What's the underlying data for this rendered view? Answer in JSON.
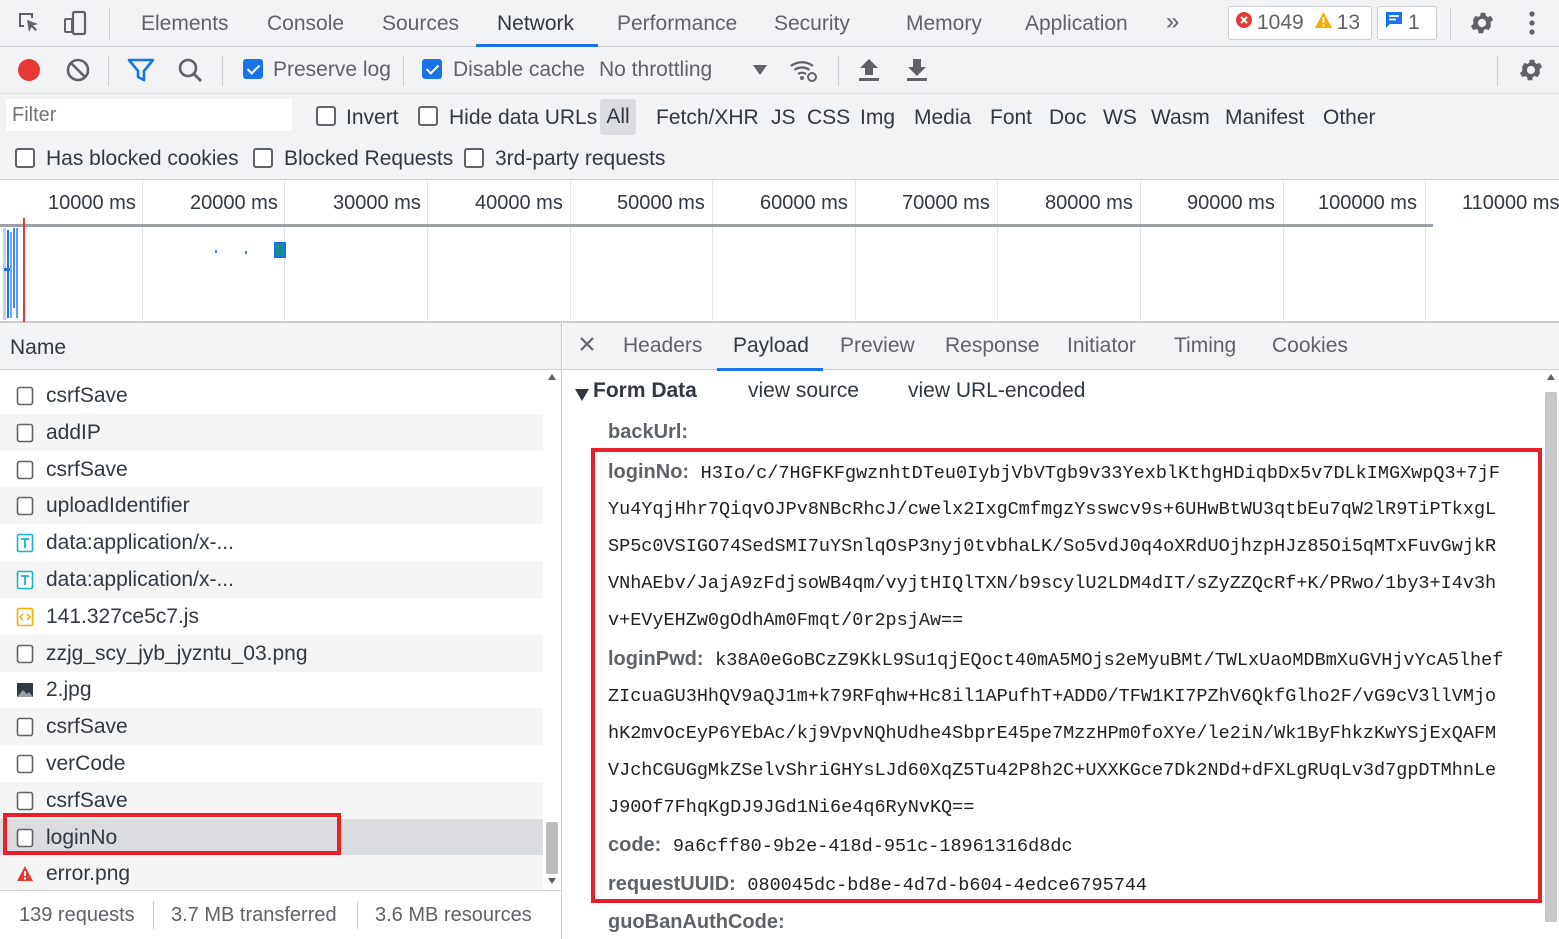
{
  "main_tabs": [
    "Elements",
    "Console",
    "Sources",
    "Network",
    "Performance",
    "Security",
    "Memory",
    "Application"
  ],
  "more_tabs_glyph": "»",
  "counters": {
    "errors": "1049",
    "warnings": "13",
    "messages": "1"
  },
  "toolbar": {
    "preserve_log": "Preserve log",
    "disable_cache": "Disable cache",
    "throttling": "No throttling"
  },
  "filter": {
    "placeholder": "Filter",
    "invert": "Invert",
    "hide_data_urls": "Hide data URLs",
    "types": [
      "All",
      "Fetch/XHR",
      "JS",
      "CSS",
      "Img",
      "Media",
      "Font",
      "Doc",
      "WS",
      "Wasm",
      "Manifest",
      "Other"
    ],
    "has_blocked_cookies": "Has blocked cookies",
    "blocked_requests": "Blocked Requests",
    "third_party": "3rd-party requests"
  },
  "timeline": {
    "ticks": [
      "10000 ms",
      "20000 ms",
      "30000 ms",
      "40000 ms",
      "50000 ms",
      "60000 ms",
      "70000 ms",
      "80000 ms",
      "90000 ms",
      "100000 ms",
      "110000 ms"
    ]
  },
  "requests": {
    "header": "Name",
    "rows": [
      {
        "name": "csrfSave",
        "icon": "doc-icon"
      },
      {
        "name": "addIP",
        "icon": "doc-icon"
      },
      {
        "name": "csrfSave",
        "icon": "doc-icon"
      },
      {
        "name": "uploadIdentifier",
        "icon": "doc-icon"
      },
      {
        "name": "data:application/x-...",
        "icon": "text-file-icon"
      },
      {
        "name": "data:application/x-...",
        "icon": "text-file-icon"
      },
      {
        "name": "141.327ce5c7.js",
        "icon": "script-icon"
      },
      {
        "name": "zzjg_scy_jyb_jyzntu_03.png",
        "icon": "doc-icon"
      },
      {
        "name": "2.jpg",
        "icon": "image-icon"
      },
      {
        "name": "csrfSave",
        "icon": "doc-icon"
      },
      {
        "name": "verCode",
        "icon": "doc-icon"
      },
      {
        "name": "csrfSave",
        "icon": "doc-icon"
      },
      {
        "name": "loginNo",
        "icon": "doc-icon"
      },
      {
        "name": "error.png",
        "icon": "error-image-icon"
      }
    ],
    "selected": "loginNo"
  },
  "status": {
    "requests": "139 requests",
    "transferred": "3.7 MB transferred",
    "resources": "3.6 MB resources"
  },
  "detail_tabs": [
    "Headers",
    "Payload",
    "Preview",
    "Response",
    "Initiator",
    "Timing",
    "Cookies"
  ],
  "active_detail_tab": "Payload",
  "form_data": {
    "title": "Form Data",
    "view_source": "view source",
    "view_url_encoded": "view URL-encoded",
    "fields": {
      "backUrl": {
        "key": "backUrl:"
      },
      "loginNo": {
        "key": "loginNo:",
        "lines": [
          "H3Io/c/7HGFKFgwznhtDTeu0IybjVbVTgb9v33YexblKthgHDiqbDx5v7DLkIMGXwpQ3+7jF",
          "Yu4YqjHhr7QiqvOJPv8NBcRhcJ/cwelx2IxgCmfmgzYsswcv9s+6UHwBtWU3qtbEu7qW2lR9TiPTkxgL",
          "SP5c0VSIGO74SedSMI7uYSnlqOsP3nyj0tvbhaLK/So5vdJ0q4oXRdUOjhzpHJz85Oi5qMTxFuvGwjkR",
          "VNhAEbv/JajA9zFdjsoWB4qm/vyjtHIQlTXN/b9scylU2LDM4dIT/sZyZZQcRf+K/PRwo/1by3+I4v3h",
          "v+EVyEHZw0gOdhAm0Fmqt/0r2psjAw=="
        ]
      },
      "loginPwd": {
        "key": "loginPwd:",
        "lines": [
          "k38A0eGoBCzZ9KkL9Su1qjEQoct40mA5MOjs2eMyuBMt/TWLxUaoMDBmXuGVHjvYcA5lhef",
          "ZIcuaGU3HhQV9aQJ1m+k79RFqhw+Hc8il1APufhT+ADD0/TFW1KI7PZhV6QkfGlho2F/vG9cV3llVMjo",
          "hK2mvOcEyP6YEbAc/kj9VpvNQhUdhe4SbprE45pe7MzzHPm0foXYe/le2iN/Wk1ByFhkzKwYSjExQAFM",
          "VJchCGUGgMkZSelvShriGHYsLJd60XqZ5Tu42P8h2C+UXXKGce7Dk2NDd+dFXLgRUqLv3d7gpDTMhnLe",
          "J90Of7FhqKgDJ9JGd1Ni6e4q6RyNvKQ=="
        ]
      },
      "code": {
        "key": "code:",
        "value": "9a6cff80-9b2e-418d-951c-18961316d8dc"
      },
      "requestUUID": {
        "key": "requestUUID:",
        "value": "080045dc-bd8e-4d7d-b604-4edce6795744"
      },
      "guoBanAuthCode": {
        "key": "guoBanAuthCode:"
      }
    }
  },
  "colors": {
    "accent": "#1a73e8",
    "highlight": "#e8202a",
    "record": "#e53935"
  }
}
